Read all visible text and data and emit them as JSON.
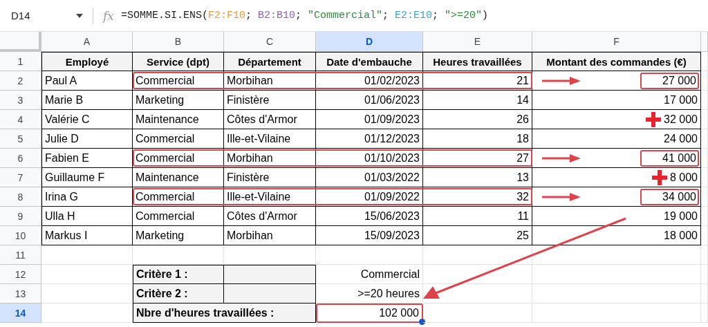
{
  "formula_bar": {
    "cell_ref": "D14",
    "fx": "fx",
    "formula": [
      {
        "text": "=SOMME.SI.ENS(",
        "color": "#1f1f1f"
      },
      {
        "text": "F2:F10",
        "color": "#f09a32"
      },
      {
        "text": "; ",
        "color": "#1f1f1f"
      },
      {
        "text": "B2:B10",
        "color": "#8a63b5"
      },
      {
        "text": "; ",
        "color": "#1f1f1f"
      },
      {
        "text": "\"Commercial\"",
        "color": "#2e8b3e"
      },
      {
        "text": "; ",
        "color": "#1f1f1f"
      },
      {
        "text": "E2:E10",
        "color": "#3aa6c9"
      },
      {
        "text": "; ",
        "color": "#1f1f1f"
      },
      {
        "text": "\">=20\"",
        "color": "#2e8b3e"
      },
      {
        "text": ")",
        "color": "#1f1f1f"
      }
    ]
  },
  "columns": [
    {
      "label": "A",
      "selected": false
    },
    {
      "label": "B",
      "selected": false
    },
    {
      "label": "C",
      "selected": false
    },
    {
      "label": "D",
      "selected": true
    },
    {
      "label": "E",
      "selected": false
    },
    {
      "label": "F",
      "selected": false
    }
  ],
  "header": {
    "number": "1",
    "selected": false,
    "cells": [
      "Employé",
      "Service (dpt)",
      "Département",
      "Date d'embauche",
      "Heures travaillées",
      "Montant des commandes (€)"
    ]
  },
  "records": [
    {
      "number": "2",
      "selected": false,
      "highlight": true,
      "cross": false,
      "cells": [
        "Paul A",
        "Commercial",
        "Morbihan",
        "01/02/2023",
        "21",
        "27 000"
      ]
    },
    {
      "number": "3",
      "selected": false,
      "highlight": false,
      "cross": false,
      "cells": [
        "Marie B",
        "Marketing",
        "Finistère",
        "01/06/2023",
        "14",
        "17 000"
      ]
    },
    {
      "number": "4",
      "selected": false,
      "highlight": false,
      "cross": true,
      "cells": [
        "Valérie C",
        "Maintenance",
        "Côtes d'Armor",
        "01/09/2023",
        "26",
        "32 000"
      ]
    },
    {
      "number": "5",
      "selected": false,
      "highlight": false,
      "cross": false,
      "cells": [
        "Julie D",
        "Commercial",
        "Ille-et-Vilaine",
        "01/12/2023",
        "18",
        "24 000"
      ]
    },
    {
      "number": "6",
      "selected": false,
      "highlight": true,
      "cross": false,
      "cells": [
        "Fabien E",
        "Commercial",
        "Morbihan",
        "01/10/2023",
        "27",
        "41 000"
      ]
    },
    {
      "number": "7",
      "selected": false,
      "highlight": false,
      "cross": true,
      "cells": [
        "Guillaume F",
        "Maintenance",
        "Finistère",
        "01/03/2022",
        "13",
        "8 000"
      ]
    },
    {
      "number": "8",
      "selected": false,
      "highlight": true,
      "cross": false,
      "cells": [
        "Irina G",
        "Commercial",
        "Ille-et-Vilaine",
        "01/09/2022",
        "32",
        "34 000"
      ]
    },
    {
      "number": "9",
      "selected": false,
      "highlight": false,
      "cross": false,
      "cells": [
        "Ulla H",
        "Commercial",
        "Côtes d'Armor",
        "15/06/2023",
        "11",
        "19 000"
      ]
    },
    {
      "number": "10",
      "selected": false,
      "highlight": false,
      "cross": false,
      "cells": [
        "Markus I",
        "Marketing",
        "Morbihan",
        "15/09/2023",
        "25",
        "18 000"
      ]
    }
  ],
  "empty_row": {
    "number": "11",
    "selected": false
  },
  "criteria": [
    {
      "number": "12",
      "selected": false,
      "kind": "split",
      "highlight": false,
      "label": "Critère 1 :",
      "value": "Commercial"
    },
    {
      "number": "13",
      "selected": false,
      "kind": "split",
      "highlight": false,
      "label": "Critère 2 :",
      "value": ">=20 heures"
    },
    {
      "number": "14",
      "selected": true,
      "kind": "merged",
      "highlight": true,
      "label": "Nbre d'heures travaillées :",
      "value": "102 000"
    }
  ]
}
